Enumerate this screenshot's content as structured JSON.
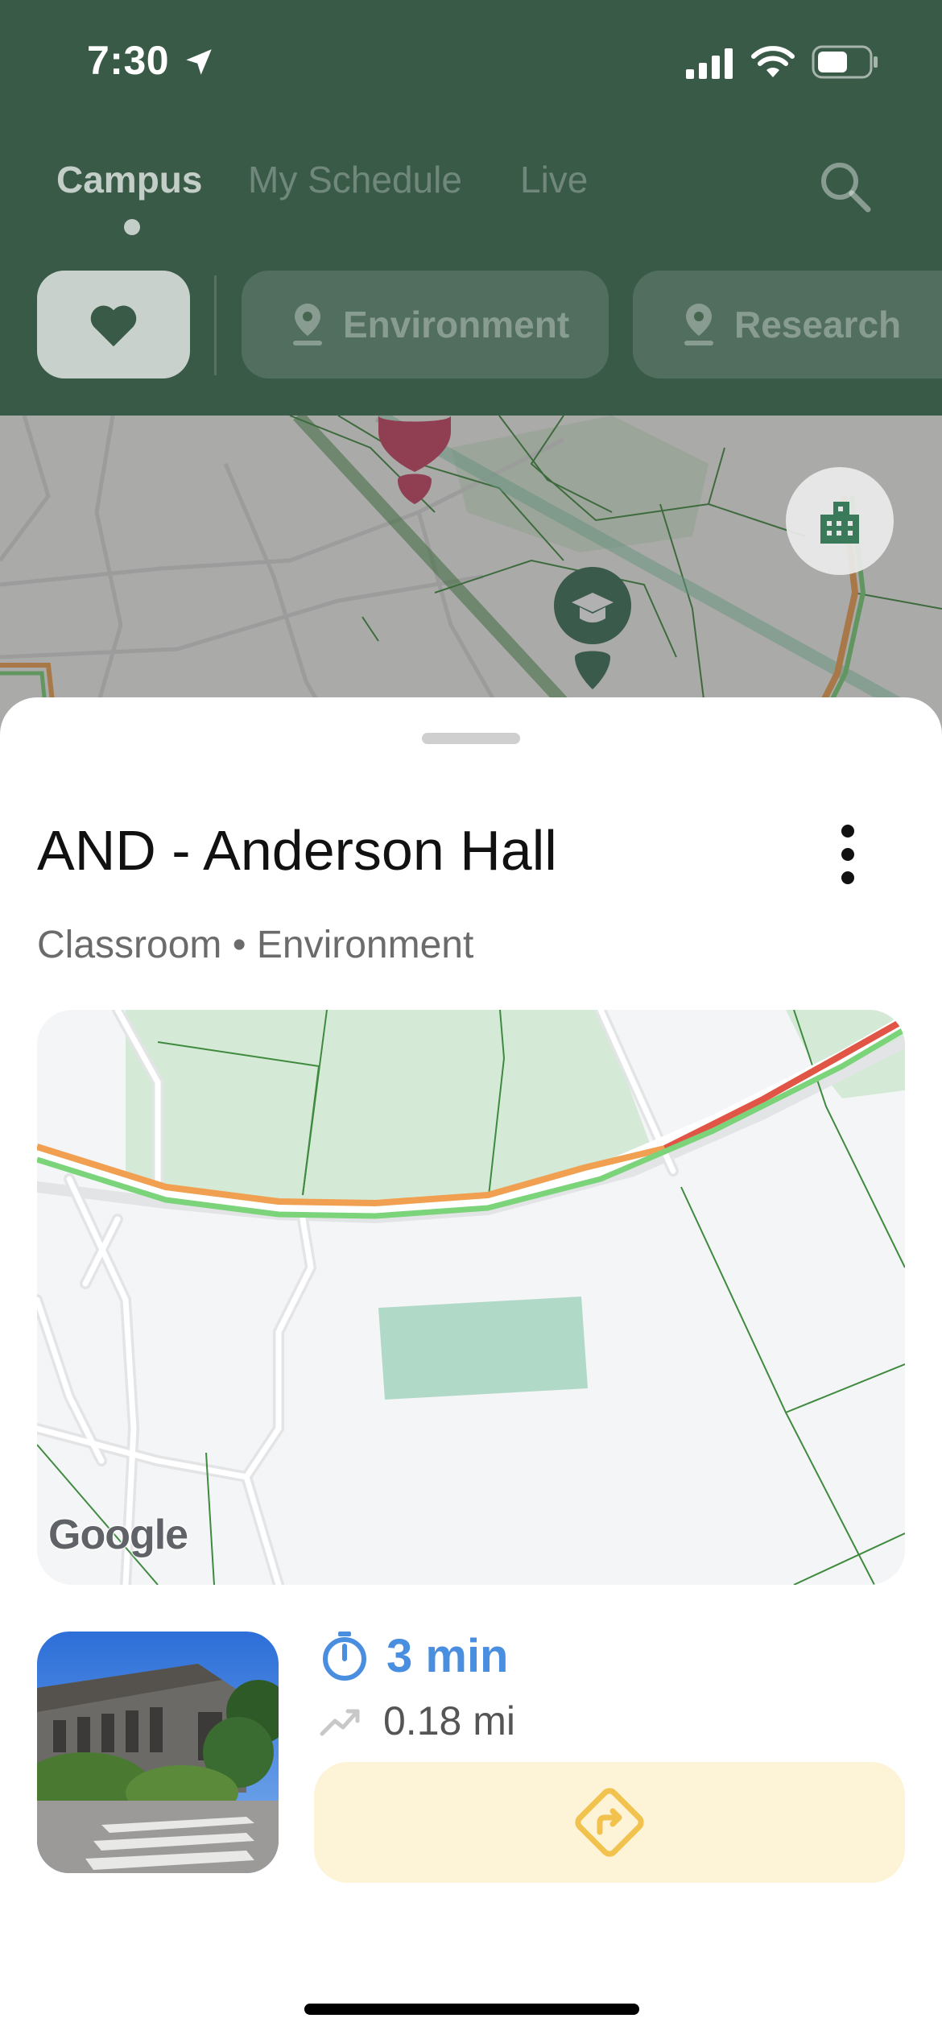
{
  "status_bar": {
    "time": "7:30"
  },
  "tabs": [
    {
      "label": "Campus",
      "active": true
    },
    {
      "label": "My Schedule",
      "active": false
    },
    {
      "label": "Live",
      "active": false
    }
  ],
  "chips": [
    {
      "label": "Environment",
      "icon": "map-pin-icon"
    },
    {
      "label": "Research",
      "icon": "map-pin-icon"
    }
  ],
  "sheet": {
    "title": "AND - Anderson Hall",
    "subtitle": "Classroom • Environment",
    "map_attribution": "Google",
    "eta": "3 min",
    "distance": "0.18 mi"
  },
  "colors": {
    "header_green": "#3a5a48",
    "accent_blue": "#4a8ee0",
    "directions_bg": "#fdf3d7",
    "directions_icon": "#f2c24e",
    "route_green": "#7bd37a",
    "route_orange": "#f0a050",
    "route_red": "#e05545",
    "building_fill": "#b0d9c8",
    "marker_red": "#c94060"
  }
}
